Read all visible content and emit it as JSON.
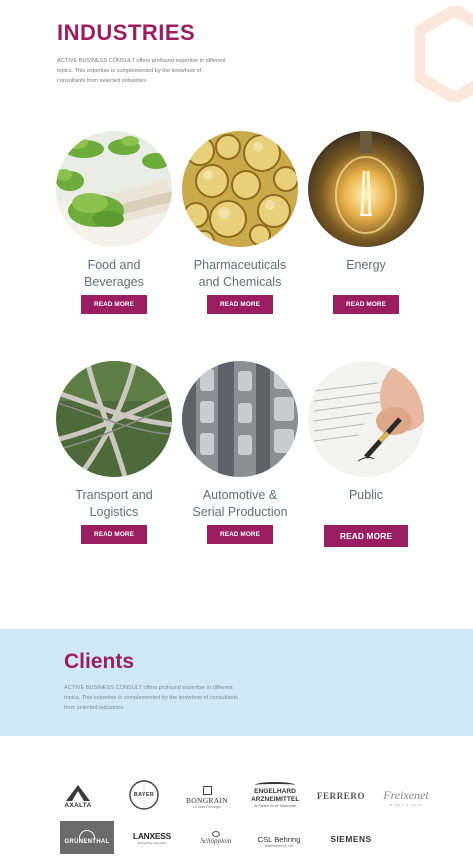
{
  "industries": {
    "title": "INDUSTRIES",
    "intro": "ACTIVE BUSINESS CONSULT offers profound expertise in different topics. This expertise is complemented by the knowhow of consultants from selected industries.",
    "cards": [
      {
        "line1": "Food and",
        "line2": "Beverages",
        "button": "READ MORE"
      },
      {
        "line1": "Pharmaceuticals",
        "line2": "and Chemicals",
        "button": "READ MORE"
      },
      {
        "line1": "Energy",
        "line2": "",
        "button": "READ MORE"
      },
      {
        "line1": "Transport and",
        "line2": "Logistics",
        "button": "READ MORE"
      },
      {
        "line1": "Automotive &",
        "line2": "Serial Production",
        "button": "READ MORE"
      },
      {
        "line1": "Public",
        "line2": "",
        "button": "READ MORE"
      }
    ]
  },
  "clients": {
    "title": "Clients",
    "intro": "ACTIVE BUSINESS CONSULT offers profound expertise in different topics. This expertise is complemented by the knowhow of consultants from selected industries.",
    "logos": [
      "AXALTA",
      "BAYER",
      "BONGRAIN",
      "ENGELHARD ARZNEIMITTEL",
      "FERRERO",
      "Freixenet",
      "GRÜNENTHAL",
      "LANXESS",
      "Schöpplein",
      "CSL Behring",
      "SIEMENS"
    ],
    "logo_sublines": {
      "bongrain": "Le Goût Fromager",
      "engelhard": "Ihr Partner für die Gesundheit",
      "freixenet": "WINES & CAVA",
      "lanxess": "Energizing Chemistry",
      "csl": "Biotherapies for Life"
    }
  },
  "colors": {
    "accent": "#9c1e62",
    "band": "#cfe8f6",
    "title_gray": "#5f6f79"
  }
}
